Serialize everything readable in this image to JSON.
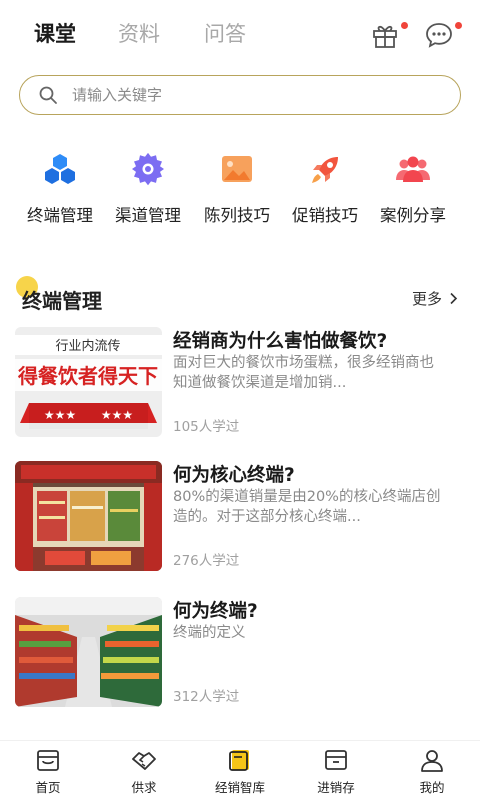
{
  "tabs": [
    {
      "label": "课堂",
      "active": true
    },
    {
      "label": "资料",
      "active": false
    },
    {
      "label": "问答",
      "active": false
    }
  ],
  "header_icons": [
    "gift-icon",
    "chat-bubble-icon"
  ],
  "search": {
    "placeholder": "请输入关键字"
  },
  "categories": [
    {
      "label": "终端管理",
      "icon": "hexagon-cluster-icon",
      "color": "#1e7cf2"
    },
    {
      "label": "渠道管理",
      "icon": "gear-icon",
      "color": "#7a6cf0"
    },
    {
      "label": "陈列技巧",
      "icon": "picture-icon",
      "color": "#f5914a"
    },
    {
      "label": "促销技巧",
      "icon": "rocket-icon",
      "color": "#f2553e"
    },
    {
      "label": "案例分享",
      "icon": "people-icon",
      "color": "#f2464f"
    }
  ],
  "section": {
    "title": "终端管理",
    "more": "更多"
  },
  "articles": [
    {
      "title": "经销商为什么害怕做餐饮?",
      "desc": "面对巨大的餐饮市场蛋糕，很多经销商也知道做餐饮渠道是增加销...",
      "count": "105人学过",
      "thumb": {
        "line1": "行业内流传",
        "line2": "得餐饮者得天下",
        "stars": "★★★"
      }
    },
    {
      "title": "何为核心终端?",
      "desc": "80%的渠道销量是由20%的核心终端店创造的。对于这部分核心终端...",
      "count": "276人学过"
    },
    {
      "title": "何为终端?",
      "desc": "终端的定义",
      "count": "312人学过"
    }
  ],
  "bottom_nav": [
    {
      "label": "首页",
      "icon": "store-icon",
      "active": false
    },
    {
      "label": "供求",
      "icon": "handshake-icon",
      "active": false
    },
    {
      "label": "经销智库",
      "icon": "book-icon",
      "active": true
    },
    {
      "label": "进销存",
      "icon": "inventory-box-icon",
      "active": false
    },
    {
      "label": "我的",
      "icon": "user-icon",
      "active": false
    }
  ],
  "colors": {
    "accent": "#f5c518",
    "badge": "#f0443a",
    "search_border": "#b8a45c"
  }
}
